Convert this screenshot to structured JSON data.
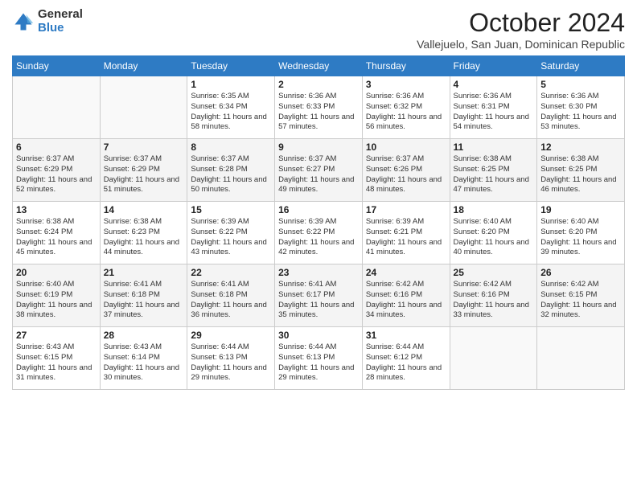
{
  "header": {
    "logo_general": "General",
    "logo_blue": "Blue",
    "month_title": "October 2024",
    "subtitle": "Vallejuelo, San Juan, Dominican Republic"
  },
  "days_of_week": [
    "Sunday",
    "Monday",
    "Tuesday",
    "Wednesday",
    "Thursday",
    "Friday",
    "Saturday"
  ],
  "weeks": [
    [
      {
        "day": "",
        "sunrise": "",
        "sunset": "",
        "daylight": ""
      },
      {
        "day": "",
        "sunrise": "",
        "sunset": "",
        "daylight": ""
      },
      {
        "day": "1",
        "sunrise": "Sunrise: 6:35 AM",
        "sunset": "Sunset: 6:34 PM",
        "daylight": "Daylight: 11 hours and 58 minutes."
      },
      {
        "day": "2",
        "sunrise": "Sunrise: 6:36 AM",
        "sunset": "Sunset: 6:33 PM",
        "daylight": "Daylight: 11 hours and 57 minutes."
      },
      {
        "day": "3",
        "sunrise": "Sunrise: 6:36 AM",
        "sunset": "Sunset: 6:32 PM",
        "daylight": "Daylight: 11 hours and 56 minutes."
      },
      {
        "day": "4",
        "sunrise": "Sunrise: 6:36 AM",
        "sunset": "Sunset: 6:31 PM",
        "daylight": "Daylight: 11 hours and 54 minutes."
      },
      {
        "day": "5",
        "sunrise": "Sunrise: 6:36 AM",
        "sunset": "Sunset: 6:30 PM",
        "daylight": "Daylight: 11 hours and 53 minutes."
      }
    ],
    [
      {
        "day": "6",
        "sunrise": "Sunrise: 6:37 AM",
        "sunset": "Sunset: 6:29 PM",
        "daylight": "Daylight: 11 hours and 52 minutes."
      },
      {
        "day": "7",
        "sunrise": "Sunrise: 6:37 AM",
        "sunset": "Sunset: 6:29 PM",
        "daylight": "Daylight: 11 hours and 51 minutes."
      },
      {
        "day": "8",
        "sunrise": "Sunrise: 6:37 AM",
        "sunset": "Sunset: 6:28 PM",
        "daylight": "Daylight: 11 hours and 50 minutes."
      },
      {
        "day": "9",
        "sunrise": "Sunrise: 6:37 AM",
        "sunset": "Sunset: 6:27 PM",
        "daylight": "Daylight: 11 hours and 49 minutes."
      },
      {
        "day": "10",
        "sunrise": "Sunrise: 6:37 AM",
        "sunset": "Sunset: 6:26 PM",
        "daylight": "Daylight: 11 hours and 48 minutes."
      },
      {
        "day": "11",
        "sunrise": "Sunrise: 6:38 AM",
        "sunset": "Sunset: 6:25 PM",
        "daylight": "Daylight: 11 hours and 47 minutes."
      },
      {
        "day": "12",
        "sunrise": "Sunrise: 6:38 AM",
        "sunset": "Sunset: 6:25 PM",
        "daylight": "Daylight: 11 hours and 46 minutes."
      }
    ],
    [
      {
        "day": "13",
        "sunrise": "Sunrise: 6:38 AM",
        "sunset": "Sunset: 6:24 PM",
        "daylight": "Daylight: 11 hours and 45 minutes."
      },
      {
        "day": "14",
        "sunrise": "Sunrise: 6:38 AM",
        "sunset": "Sunset: 6:23 PM",
        "daylight": "Daylight: 11 hours and 44 minutes."
      },
      {
        "day": "15",
        "sunrise": "Sunrise: 6:39 AM",
        "sunset": "Sunset: 6:22 PM",
        "daylight": "Daylight: 11 hours and 43 minutes."
      },
      {
        "day": "16",
        "sunrise": "Sunrise: 6:39 AM",
        "sunset": "Sunset: 6:22 PM",
        "daylight": "Daylight: 11 hours and 42 minutes."
      },
      {
        "day": "17",
        "sunrise": "Sunrise: 6:39 AM",
        "sunset": "Sunset: 6:21 PM",
        "daylight": "Daylight: 11 hours and 41 minutes."
      },
      {
        "day": "18",
        "sunrise": "Sunrise: 6:40 AM",
        "sunset": "Sunset: 6:20 PM",
        "daylight": "Daylight: 11 hours and 40 minutes."
      },
      {
        "day": "19",
        "sunrise": "Sunrise: 6:40 AM",
        "sunset": "Sunset: 6:20 PM",
        "daylight": "Daylight: 11 hours and 39 minutes."
      }
    ],
    [
      {
        "day": "20",
        "sunrise": "Sunrise: 6:40 AM",
        "sunset": "Sunset: 6:19 PM",
        "daylight": "Daylight: 11 hours and 38 minutes."
      },
      {
        "day": "21",
        "sunrise": "Sunrise: 6:41 AM",
        "sunset": "Sunset: 6:18 PM",
        "daylight": "Daylight: 11 hours and 37 minutes."
      },
      {
        "day": "22",
        "sunrise": "Sunrise: 6:41 AM",
        "sunset": "Sunset: 6:18 PM",
        "daylight": "Daylight: 11 hours and 36 minutes."
      },
      {
        "day": "23",
        "sunrise": "Sunrise: 6:41 AM",
        "sunset": "Sunset: 6:17 PM",
        "daylight": "Daylight: 11 hours and 35 minutes."
      },
      {
        "day": "24",
        "sunrise": "Sunrise: 6:42 AM",
        "sunset": "Sunset: 6:16 PM",
        "daylight": "Daylight: 11 hours and 34 minutes."
      },
      {
        "day": "25",
        "sunrise": "Sunrise: 6:42 AM",
        "sunset": "Sunset: 6:16 PM",
        "daylight": "Daylight: 11 hours and 33 minutes."
      },
      {
        "day": "26",
        "sunrise": "Sunrise: 6:42 AM",
        "sunset": "Sunset: 6:15 PM",
        "daylight": "Daylight: 11 hours and 32 minutes."
      }
    ],
    [
      {
        "day": "27",
        "sunrise": "Sunrise: 6:43 AM",
        "sunset": "Sunset: 6:15 PM",
        "daylight": "Daylight: 11 hours and 31 minutes."
      },
      {
        "day": "28",
        "sunrise": "Sunrise: 6:43 AM",
        "sunset": "Sunset: 6:14 PM",
        "daylight": "Daylight: 11 hours and 30 minutes."
      },
      {
        "day": "29",
        "sunrise": "Sunrise: 6:44 AM",
        "sunset": "Sunset: 6:13 PM",
        "daylight": "Daylight: 11 hours and 29 minutes."
      },
      {
        "day": "30",
        "sunrise": "Sunrise: 6:44 AM",
        "sunset": "Sunset: 6:13 PM",
        "daylight": "Daylight: 11 hours and 29 minutes."
      },
      {
        "day": "31",
        "sunrise": "Sunrise: 6:44 AM",
        "sunset": "Sunset: 6:12 PM",
        "daylight": "Daylight: 11 hours and 28 minutes."
      },
      {
        "day": "",
        "sunrise": "",
        "sunset": "",
        "daylight": ""
      },
      {
        "day": "",
        "sunrise": "",
        "sunset": "",
        "daylight": ""
      }
    ]
  ]
}
